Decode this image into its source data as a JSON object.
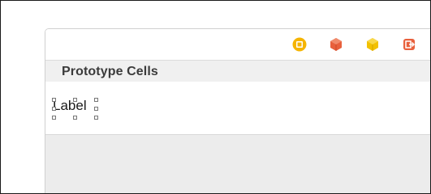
{
  "section": {
    "title": "Prototype Cells"
  },
  "cell": {
    "label": "Label"
  },
  "dock": {
    "icons": [
      {
        "name": "view-controller-icon",
        "color": "#f5b400"
      },
      {
        "name": "first-responder-icon",
        "color": "#e8603c"
      },
      {
        "name": "object-icon",
        "color": "#f2c100"
      },
      {
        "name": "exit-icon",
        "color": "#e8603c"
      }
    ]
  },
  "colors": {
    "section_header_bg": "#f0f0f0",
    "empty_area_bg": "#ececec",
    "selection_handle": "#777777"
  }
}
